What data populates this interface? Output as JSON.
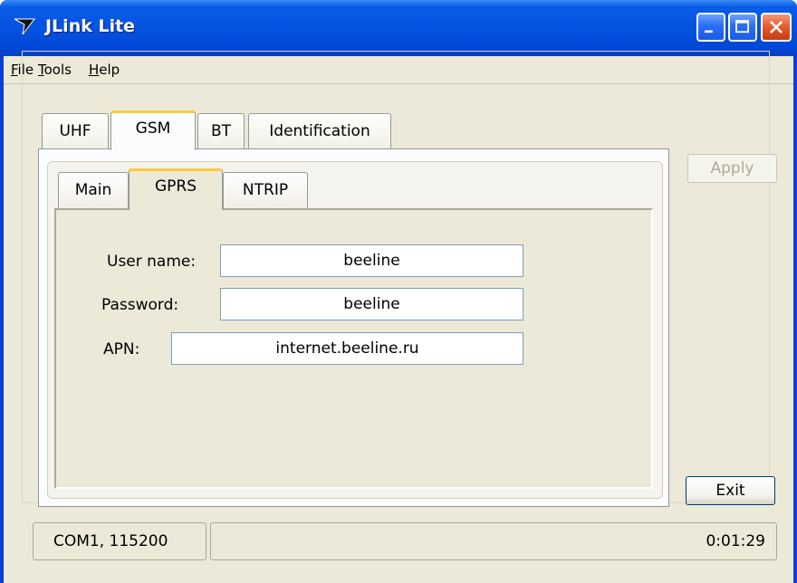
{
  "window": {
    "title": "JLink Lite"
  },
  "menu": {
    "file": {
      "mnemonic": "F",
      "rest": "ile"
    },
    "tools": {
      "mnemonic": "T",
      "rest": "ools"
    },
    "help": {
      "mnemonic": "H",
      "rest": "elp"
    }
  },
  "tabs": {
    "uhf": "UHF",
    "gsm": "GSM",
    "bt": "BT",
    "identification": "Identification",
    "active": "GSM"
  },
  "subtabs": {
    "main": "Main",
    "gprs": "GPRS",
    "ntrip": "NTRIP",
    "active": "GPRS"
  },
  "form": {
    "username_label": "User name:",
    "username_value": "beeline",
    "password_label": "Password:",
    "password_value": "beeline",
    "apn_label": "APN:",
    "apn_value": "internet.beeline.ru"
  },
  "buttons": {
    "apply": "Apply",
    "exit": "Exit"
  },
  "status": {
    "port": "COM1, 115200",
    "message": "",
    "elapsed": "0:01:29"
  },
  "colors": {
    "titlebar": "#0553e0",
    "active_tab_accent": "#ffc83c",
    "close_button": "#e25a2c",
    "face": "#ece9d8"
  }
}
